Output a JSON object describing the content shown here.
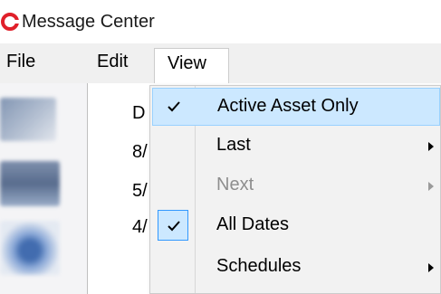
{
  "window": {
    "title": "Message Center",
    "icon": "app-logo-icon"
  },
  "menubar": {
    "items": [
      {
        "label": "File"
      },
      {
        "label": "Edit"
      },
      {
        "label": "View"
      }
    ]
  },
  "list": {
    "header": "D",
    "rows": [
      "8/",
      "5/",
      "4/"
    ]
  },
  "view_menu": {
    "items": [
      {
        "label": "Active Asset Only",
        "checked": true,
        "highlighted": true,
        "submenu": false,
        "enabled": true
      },
      {
        "label": "Last",
        "checked": false,
        "highlighted": false,
        "submenu": true,
        "enabled": true
      },
      {
        "label": "Next",
        "checked": false,
        "highlighted": false,
        "submenu": true,
        "enabled": false
      },
      {
        "label": "All Dates",
        "checked": true,
        "highlighted": false,
        "submenu": false,
        "enabled": true
      },
      {
        "label": "Schedules",
        "checked": false,
        "highlighted": false,
        "submenu": true,
        "enabled": true
      }
    ]
  },
  "colors": {
    "highlight": "#cce8ff",
    "highlight_border": "#99d1ff",
    "check_border": "#3399ff",
    "menu_bg": "#f2f2f2",
    "disabled_text": "#8e8e8e",
    "logo_red": "#e0202a"
  }
}
